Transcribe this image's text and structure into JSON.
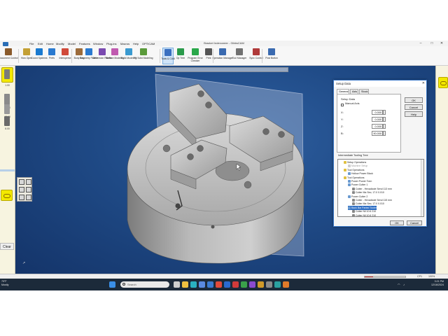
{
  "window": {
    "title": "Bracket Indexoneer - GibbsCAM",
    "controls": [
      "–",
      "□",
      "✕"
    ]
  },
  "menu": {
    "items": [
      "File",
      "Edit",
      "Home",
      "Modify",
      "Model",
      "Features",
      "Window",
      "Plug-ins",
      "Macros",
      "Help",
      "OPTICAM"
    ]
  },
  "ribbon": {
    "buttons": [
      {
        "label": "Document Control",
        "icon": "document-icon",
        "color": "#8a5a2b"
      },
      {
        "label": "How Open",
        "icon": "folder-icon",
        "color": "#c4a035"
      },
      {
        "label": "Coord Systems",
        "icon": "axes-icon",
        "color": "#1a7ad0"
      },
      {
        "label": "Prefs",
        "icon": "prefs-icon",
        "color": "#2a7ad0"
      },
      {
        "label": "Intersperse",
        "icon": "intersperse-icon",
        "color": "#d04a3a"
      },
      {
        "label": "Body Bag",
        "icon": "bag-icon",
        "color": "#9c6b3a"
      },
      {
        "label": "Geometry Palette",
        "icon": "geometry-icon",
        "color": "#2a7ad0"
      },
      {
        "label": "Dimension Palette",
        "icon": "dimension-icon",
        "color": "#7a4ab0"
      },
      {
        "label": "Surface Modeling",
        "icon": "surface-icon",
        "color": "#c05ab0"
      },
      {
        "label": "Solid Modeling",
        "icon": "solid-icon",
        "color": "#3a9ad0"
      },
      {
        "label": "Fit Solid Modeling",
        "icon": "fitsolid-icon",
        "color": "#5a9a3a"
      },
      {
        "label": "Tools & CAM",
        "icon": "tools-icon",
        "color": "#3a70c0",
        "selected": true
      },
      {
        "label": "Op Tree",
        "icon": "optree-icon",
        "color": "#2a9a4a"
      },
      {
        "label": "Program Error Checker",
        "icon": "check-icon",
        "color": "#2aa84a"
      },
      {
        "label": "Print",
        "icon": "print-icon",
        "color": "#555555"
      },
      {
        "label": "Operation Manager",
        "icon": "opmanager-icon",
        "color": "#3a6ab0"
      },
      {
        "label": "Tool Manager",
        "icon": "toolmanager-icon",
        "color": "#707070"
      },
      {
        "label": "Sync Control",
        "icon": "sync-icon",
        "color": "#b03a3a"
      },
      {
        "label": "Post Button",
        "icon": "post-icon",
        "color": "#3a6ab0"
      }
    ]
  },
  "left_tools": [
    {
      "label": "1.00"
    },
    {
      "label": "10.00"
    },
    {
      "label": "12.00"
    },
    {
      "label": "8.00"
    }
  ],
  "left_clear": "Clear",
  "status": {
    "left": "CP1",
    "zoom": "100%"
  },
  "dialog": {
    "title": "Setup Data",
    "tabs": [
      "General",
      "Axis",
      "Stock"
    ],
    "setup_data_label": "Setup Data",
    "manual_axis_label": "Manual Axis",
    "axes": [
      {
        "name": "X:",
        "value": "0.000"
      },
      {
        "name": "Y:",
        "value": "0.000"
      },
      {
        "name": "Z:",
        "value": "0.000"
      },
      {
        "name": "B:",
        "value": "90.000"
      }
    ],
    "buttons": [
      "OK",
      "Cancel",
      "Help"
    ],
    "tree_label": "Intermediate Tooling Tree",
    "tree": [
      {
        "text": "Setup Operations",
        "indent": 1,
        "icon": "#e0c040"
      },
      {
        "text": "Machine Setup",
        "indent": 2,
        "icon": "#cccccc",
        "gray": true
      },
      {
        "text": "Tool Operations",
        "indent": 1,
        "icon": "#e0c040"
      },
      {
        "text": "Hollow Power Block",
        "indent": 2,
        "icon": "#6a9ad0"
      },
      {
        "text": "Tool Operations",
        "indent": 1,
        "icon": "#e0c040"
      },
      {
        "text": "Power Power Tonn",
        "indent": 2,
        "icon": "#6a9ad0"
      },
      {
        "text": "Power Cutter 1",
        "indent": 2,
        "icon": "#6a9ad0"
      },
      {
        "text": "Cutter - Hexadiode Send 113 mm",
        "indent": 3,
        "icon": "#888888"
      },
      {
        "text": "Cutter Ma Sec; 17.0 0.010",
        "indent": 3,
        "icon": "#888888"
      },
      {
        "text": "Power Cutter 2",
        "indent": 2,
        "icon": "#6a9ad0"
      },
      {
        "text": "Cutter - Hexadiode Send 115 mm",
        "indent": 3,
        "icon": "#888888"
      },
      {
        "text": "Cutter Ma Sec; 17.0 0.010",
        "indent": 3,
        "icon": "#888888"
      },
      {
        "text": "Back Bar Parted Tooler",
        "indent": 2,
        "icon": "#6a9ad0",
        "selected": true
      },
      {
        "text": "Cutter Nil 10.6 210",
        "indent": 3,
        "icon": "#888888"
      },
      {
        "text": "Cutter Nil 10.6 210",
        "indent": 3,
        "icon": "#888888"
      }
    ],
    "bottom_buttons": [
      "OK",
      "Cancel"
    ]
  },
  "taskbar": {
    "weather_temp": "79°F",
    "weather_desc": "Mostly",
    "search_placeholder": "Search",
    "time": "3:21 PM",
    "date": "12/16/2024",
    "icons": [
      {
        "name": "start",
        "color": "#3a8ee6"
      },
      {
        "name": "task-view",
        "color": "#cfcfcf"
      },
      {
        "name": "explorer",
        "color": "#f0c040"
      },
      {
        "name": "edge",
        "color": "#2ab0c0"
      },
      {
        "name": "store",
        "color": "#5a8ae0"
      },
      {
        "name": "mail",
        "color": "#3a7ad0"
      },
      {
        "name": "chrome",
        "color": "#e04a3a"
      },
      {
        "name": "app-blue",
        "color": "#2a6ad0"
      },
      {
        "name": "app-red",
        "color": "#d03a3a"
      },
      {
        "name": "app-green",
        "color": "#3aa04a"
      },
      {
        "name": "app-purple",
        "color": "#8a4ad0"
      },
      {
        "name": "app-gibbs",
        "color": "#d09a2a"
      },
      {
        "name": "app-gray",
        "color": "#8a8a8a"
      },
      {
        "name": "app-teal",
        "color": "#2aa0a0"
      },
      {
        "name": "app-orange",
        "color": "#e07a2a"
      }
    ]
  }
}
